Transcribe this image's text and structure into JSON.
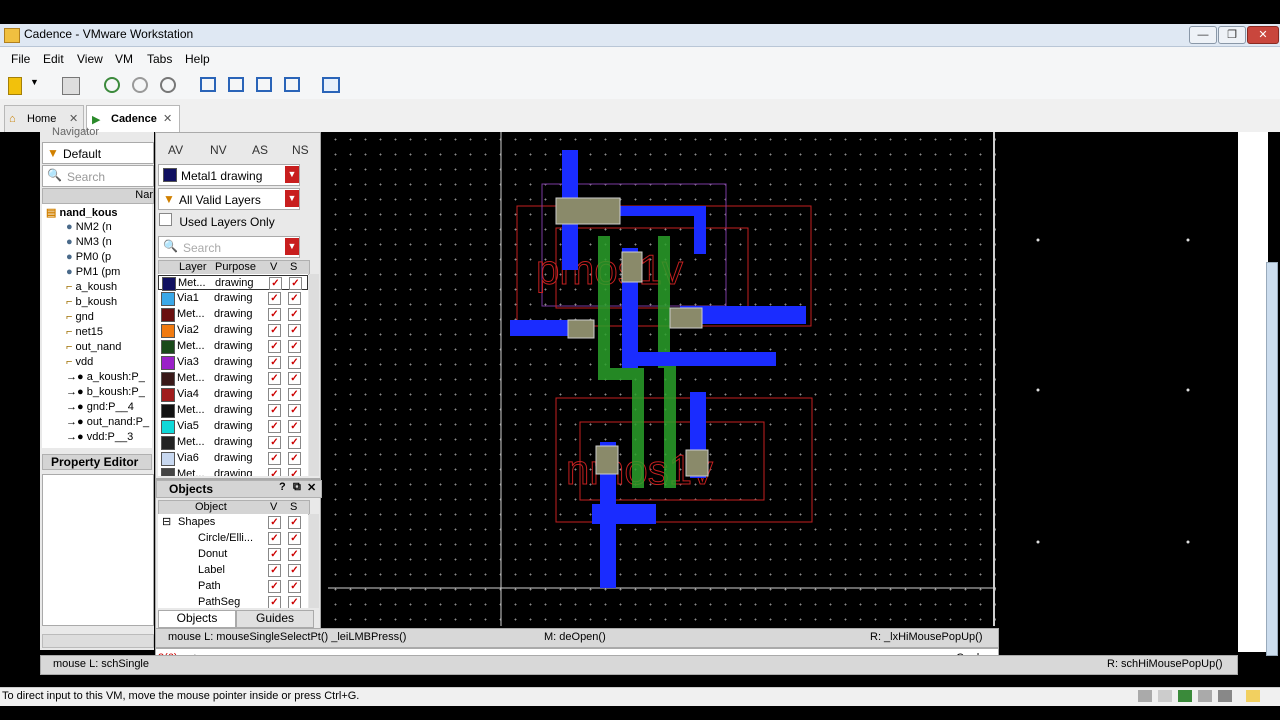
{
  "window": {
    "title": "Cadence - VMware Workstation"
  },
  "menu": [
    "File",
    "Edit",
    "View",
    "VM",
    "Tabs",
    "Help"
  ],
  "tabs": [
    {
      "label": "Home"
    },
    {
      "label": "Cadence"
    }
  ],
  "navigator": {
    "title": "Navigator",
    "filter": "Default",
    "search_placeholder": "Search",
    "col_name": "Nar",
    "root": "nand_kous",
    "items": [
      "NM2 (n",
      "NM3 (n",
      "PM0 (p",
      "PM1 (pm",
      "a_koush",
      "b_koush",
      "gnd",
      "net15",
      "out_nand",
      "vdd",
      "a_koush:P_",
      "b_koush:P_",
      "gnd:P__4",
      "out_nand:P_",
      "vdd:P__3"
    ]
  },
  "property_editor": {
    "title": "Property Editor"
  },
  "layers": {
    "title": "Layers",
    "cols": [
      "AV",
      "NV",
      "AS",
      "NS"
    ],
    "current": "Metal1 drawing",
    "filter": "All Valid Layers",
    "used_only": "Used Layers Only",
    "search_placeholder": "Search",
    "headers": [
      "Layer",
      "Purpose",
      "V",
      "S"
    ],
    "rows": [
      {
        "layer": "Met...",
        "purpose": "drawing",
        "color": "#101060"
      },
      {
        "layer": "Via1",
        "purpose": "drawing",
        "color": "#3aa8e8"
      },
      {
        "layer": "Met...",
        "purpose": "drawing",
        "color": "#6a1010"
      },
      {
        "layer": "Via2",
        "purpose": "drawing",
        "color": "#f07a10"
      },
      {
        "layer": "Met...",
        "purpose": "drawing",
        "color": "#1a4a1a"
      },
      {
        "layer": "Via3",
        "purpose": "drawing",
        "color": "#9a20c8"
      },
      {
        "layer": "Met...",
        "purpose": "drawing",
        "color": "#3a1a1a"
      },
      {
        "layer": "Via4",
        "purpose": "drawing",
        "color": "#a01c1c"
      },
      {
        "layer": "Met...",
        "purpose": "drawing",
        "color": "#111111"
      },
      {
        "layer": "Via5",
        "purpose": "drawing",
        "color": "#10d8d8"
      },
      {
        "layer": "Met...",
        "purpose": "drawing",
        "color": "#222222"
      },
      {
        "layer": "Via6",
        "purpose": "drawing",
        "color": "#c8d8f0"
      },
      {
        "layer": "Met...",
        "purpose": "drawing",
        "color": "#444444"
      }
    ]
  },
  "objects": {
    "title": "Objects",
    "headers": [
      "Object",
      "V",
      "S"
    ],
    "rows": [
      "Shapes",
      "Circle/Elli...",
      "Donut",
      "Label",
      "Path",
      "PathSeg"
    ],
    "tabs": [
      "Objects",
      "Guides"
    ]
  },
  "canvas": {
    "labels": [
      "pmos1v",
      "nmos1v"
    ]
  },
  "status": {
    "left": "mouse L: mouseSingleSelectPt() _leiLMBPress()",
    "mid": "M: deOpen()",
    "right": "R: _lxHiMousePopUp()",
    "cmd_num": "3(6)",
    "prompt": ">",
    "cmd_label": "Cmd:",
    "bottom_left": "mouse L: schSingle",
    "bottom_right": "R: schHiMousePopUp()"
  },
  "vm_status": "To direct input to this VM, move the mouse pointer inside or press Ctrl+G."
}
